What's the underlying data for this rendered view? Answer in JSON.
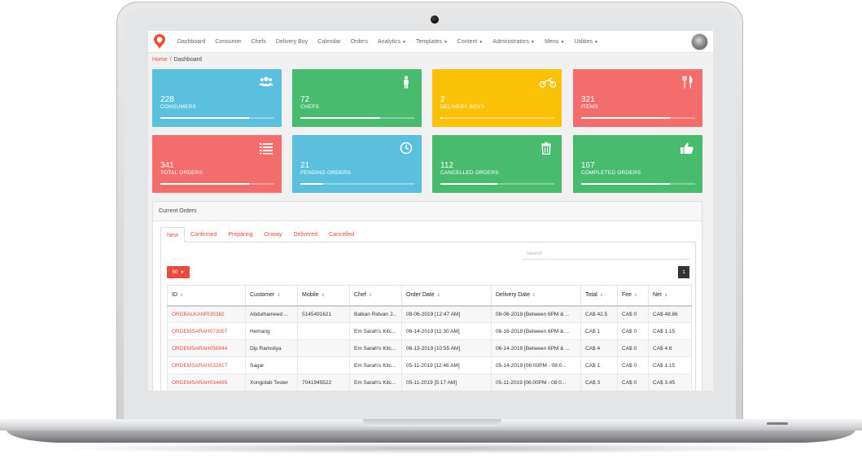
{
  "nav": {
    "items": [
      {
        "label": "Dashboard",
        "caret": false
      },
      {
        "label": "Consumer",
        "caret": false
      },
      {
        "label": "Chefs",
        "caret": false
      },
      {
        "label": "Delivery Boy",
        "caret": false
      },
      {
        "label": "Calendar",
        "caret": false
      },
      {
        "label": "Orders",
        "caret": false
      },
      {
        "label": "Analytics",
        "caret": true
      },
      {
        "label": "Templates",
        "caret": true
      },
      {
        "label": "Content",
        "caret": true
      },
      {
        "label": "Administrators",
        "caret": true
      },
      {
        "label": "Menu",
        "caret": true
      },
      {
        "label": "Utilities",
        "caret": true
      }
    ],
    "logo_icon": "location-pin-bulb-icon",
    "avatar_icon": "user-avatar"
  },
  "breadcrumb": {
    "home": "Home",
    "separator": "/",
    "current": "Dashboard"
  },
  "cards": [
    {
      "value": "228",
      "label": "CONSUMERS",
      "progress": 0.78,
      "color": "#5bc0de",
      "icon": "users-icon"
    },
    {
      "value": "72",
      "label": "CHEFS",
      "progress": 0.7,
      "color": "#48bb6f",
      "icon": "person-icon"
    },
    {
      "value": "2",
      "label": "DELIVERY BOYS",
      "progress": 0.02,
      "color": "#fbc107",
      "icon": "motorbike-icon"
    },
    {
      "value": "321",
      "label": "ITEMS",
      "progress": 0.78,
      "color": "#f46d6d",
      "icon": "cutlery-icon"
    },
    {
      "value": "341",
      "label": "TOTAL ORDERS",
      "progress": 0.78,
      "color": "#f46d6d",
      "icon": "list-icon"
    },
    {
      "value": "21",
      "label": "PENDING ORDERS",
      "progress": 0.2,
      "color": "#5bc0de",
      "icon": "clock-icon"
    },
    {
      "value": "112",
      "label": "CANCELLED ORDERS",
      "progress": 0.5,
      "color": "#48bb6f",
      "icon": "trash-icon"
    },
    {
      "value": "167",
      "label": "COMPLETED ORDERS",
      "progress": 0.78,
      "color": "#48bb6f",
      "icon": "thumbs-up-icon"
    }
  ],
  "orders_panel": {
    "title": "Current Orders",
    "tabs": [
      "New",
      "Confirmed",
      "Preparing",
      "Onway",
      "Delivered",
      "Cancelled"
    ],
    "active_tab": "New",
    "search_placeholder": "Search",
    "per_page": "50",
    "current_page": "1",
    "columns": [
      "ID",
      "Customer",
      "Mobile",
      "Chef",
      "Order Date",
      "Delivery Date",
      "Total",
      "Fee",
      "Net"
    ],
    "rows": [
      [
        "ORDBALKANRI35382",
        "Abdulhameed ...",
        "5145491621",
        "Balkan Ridvan J...",
        "08-06-2019 [12:47 AM]",
        "08-06-2019 [Between 6PM & ...",
        "CA$ 42.5",
        "CA$ 0",
        "CA$ 48.86"
      ],
      [
        "ORDEMSARAH073057",
        "Hemang",
        "",
        "Em Sarah's Kitc...",
        "06-14-2019 [11:30 AM]",
        "06-16-2019 [Between 6PM & ...",
        "CA$ 1",
        "CA$ 0",
        "CA$ 1.15"
      ],
      [
        "ORDEMSARAH056944",
        "Dip Ramoliya",
        "",
        "Em Sarah's Kitc...",
        "06-13-2019 [10:55 AM]",
        "06-14-2019 [Between 6PM & ...",
        "CA$ 4",
        "CA$ 0",
        "CA$ 4.6"
      ],
      [
        "ORDEMSARAH032817",
        "Sagar",
        "",
        "Em Sarah's Kitc...",
        "05-11-2019 [12:46 AM]",
        "05-14-2019 [06:00PM - 08:0...",
        "CA$ 1",
        "CA$ 0",
        "CA$ 1.15"
      ],
      [
        "ORDEMSARAH034495",
        "Xongolab Tester",
        "7041945522",
        "Em Sarah's Kitc...",
        "05-11-2019 [5:17 AM]",
        "05-11-2019 [06:00PM - 08:0...",
        "CA$ 3",
        "CA$ 0",
        "CA$ 3.45"
      ]
    ]
  }
}
